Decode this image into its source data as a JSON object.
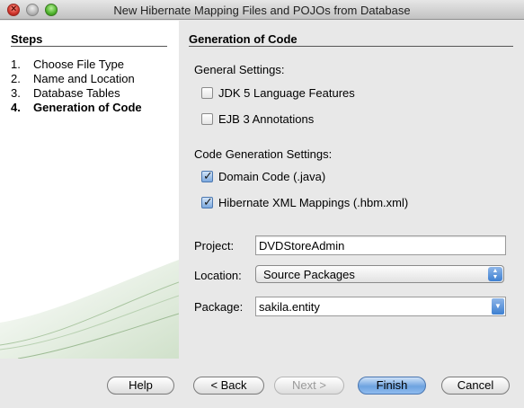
{
  "window": {
    "title": "New Hibernate Mapping Files and POJOs from Database"
  },
  "steps": {
    "heading": "Steps",
    "items": [
      {
        "num": "1.",
        "label": "Choose File Type"
      },
      {
        "num": "2.",
        "label": "Name and Location"
      },
      {
        "num": "3.",
        "label": "Database Tables"
      },
      {
        "num": "4.",
        "label": "Generation of Code"
      }
    ]
  },
  "content": {
    "heading": "Generation of Code",
    "general_settings_label": "General Settings:",
    "jdk5": {
      "label": "JDK 5 Language Features",
      "checked": false
    },
    "ejb3": {
      "label": "EJB 3 Annotations",
      "checked": false
    },
    "code_gen_label": "Code Generation Settings:",
    "domain_code": {
      "label": "Domain Code (.java)",
      "checked": true
    },
    "hbm_xml": {
      "label": "Hibernate XML Mappings (.hbm.xml)",
      "checked": true
    },
    "project": {
      "label": "Project:",
      "value": "DVDStoreAdmin"
    },
    "location": {
      "label": "Location:",
      "value": "Source Packages"
    },
    "package": {
      "label": "Package:",
      "value": "sakila.entity"
    }
  },
  "buttons": {
    "help": "Help",
    "back": "< Back",
    "next": "Next >",
    "finish": "Finish",
    "cancel": "Cancel"
  },
  "colors": {
    "accent": "#3d7fd1",
    "window_bg": "#e8e8e8"
  }
}
